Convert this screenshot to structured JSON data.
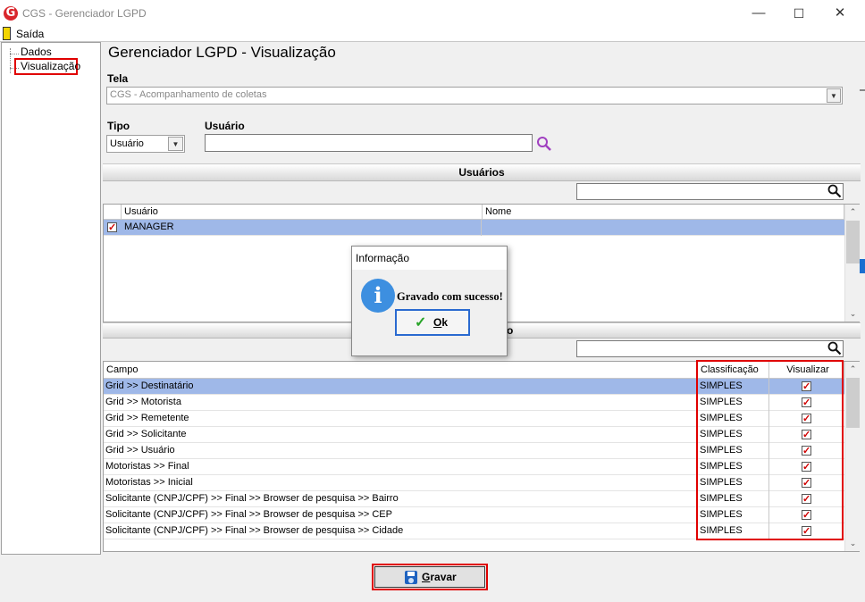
{
  "window": {
    "title": "CGS - Gerenciador LGPD",
    "minimize": "—",
    "maximize": "☐",
    "close": "✕",
    "logo": "G"
  },
  "menu": {
    "exit_label": "Saída"
  },
  "tree": {
    "items": [
      {
        "label": "Dados"
      },
      {
        "label": "Visualização"
      }
    ]
  },
  "page": {
    "heading": "Gerenciador LGPD - Visualização",
    "tela_label": "Tela",
    "tela_value": "CGS - Acompanhamento de coletas",
    "tipo_label": "Tipo",
    "tipo_value": "Usuário",
    "usuario_label": "Usuário",
    "usuario_value": ""
  },
  "users_section": {
    "title": "Usuários",
    "search_value": "",
    "columns": [
      "Usuário",
      "Nome"
    ],
    "rows": [
      {
        "usuario": "MANAGER",
        "nome": "",
        "checked": true
      }
    ]
  },
  "fields_section": {
    "title_fragment": "o",
    "search_value": "",
    "columns": [
      "Campo",
      "Classificação",
      "Visualizar"
    ],
    "rows": [
      {
        "campo": "Grid >> Destinatário",
        "classificacao": "SIMPLES",
        "visualizar": true
      },
      {
        "campo": "Grid >> Motorista",
        "classificacao": "SIMPLES",
        "visualizar": true
      },
      {
        "campo": "Grid >> Remetente",
        "classificacao": "SIMPLES",
        "visualizar": true
      },
      {
        "campo": "Grid >> Solicitante",
        "classificacao": "SIMPLES",
        "visualizar": true
      },
      {
        "campo": "Grid >> Usuário",
        "classificacao": "SIMPLES",
        "visualizar": true
      },
      {
        "campo": "Motoristas >> Final",
        "classificacao": "SIMPLES",
        "visualizar": true
      },
      {
        "campo": "Motoristas >> Inicial",
        "classificacao": "SIMPLES",
        "visualizar": true
      },
      {
        "campo": "Solicitante (CNPJ/CPF) >> Final >> Browser de pesquisa >> Bairro",
        "classificacao": "SIMPLES",
        "visualizar": true
      },
      {
        "campo": "Solicitante (CNPJ/CPF) >> Final >> Browser de pesquisa >> CEP",
        "classificacao": "SIMPLES",
        "visualizar": true
      },
      {
        "campo": "Solicitante (CNPJ/CPF) >> Final >> Browser de pesquisa >> Cidade",
        "classificacao": "SIMPLES",
        "visualizar": true
      }
    ]
  },
  "dialog": {
    "title": "Informação",
    "message": "Gravado com sucesso!",
    "ok_prefix": "O",
    "ok_rest": "k",
    "icon": "i"
  },
  "footer": {
    "save_prefix": "G",
    "save_rest": "ravar"
  },
  "colors": {
    "selection": "#9fb8e8",
    "highlight_border": "#e00000",
    "info_icon": "#3d8fe0",
    "check_mark": "#d00000",
    "search_icon": "#a040c0"
  }
}
